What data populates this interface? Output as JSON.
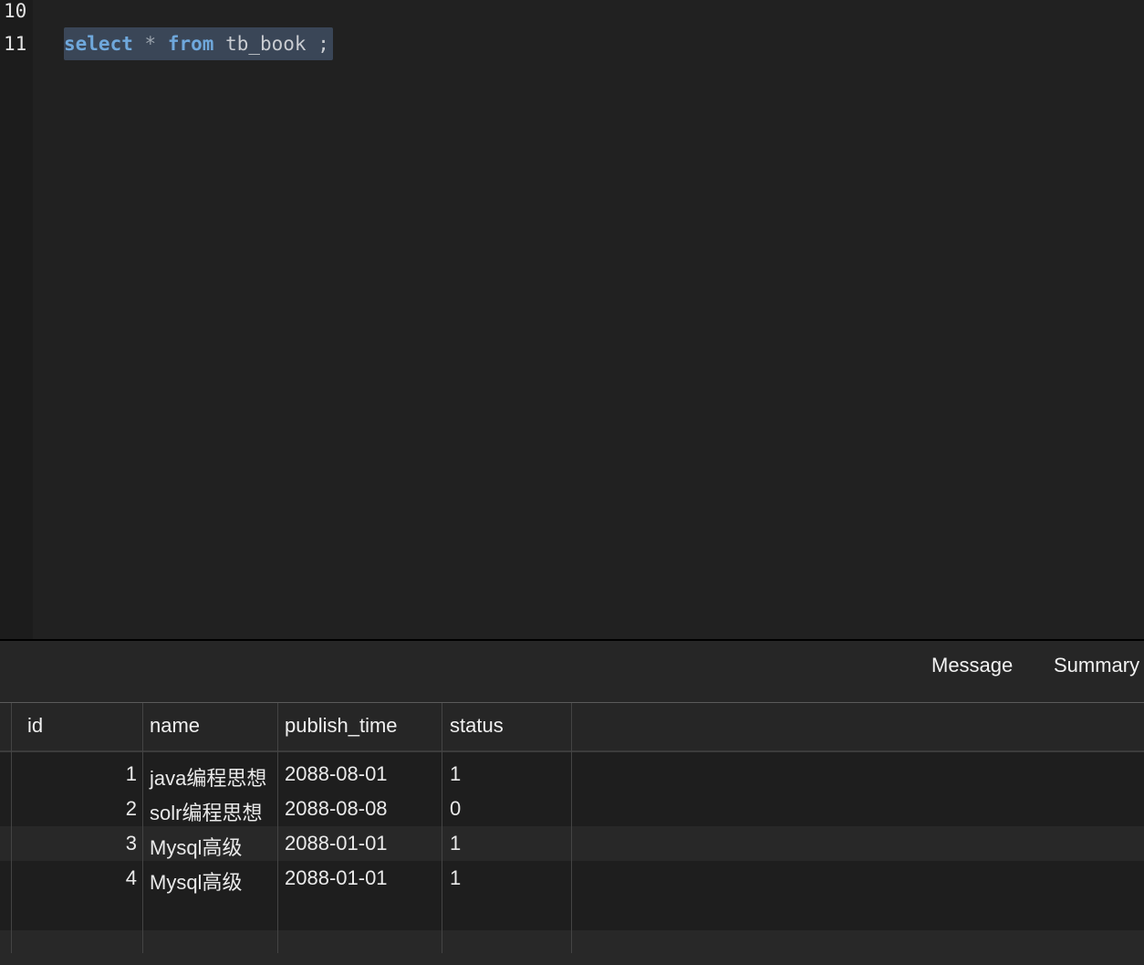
{
  "editor": {
    "line_numbers": [
      "10",
      "11"
    ],
    "query": {
      "kw_select": "select",
      "star": "*",
      "kw_from": "from",
      "table": "tb_book",
      "semicolon": ";"
    }
  },
  "results": {
    "tabs": [
      "Message",
      "Summary"
    ],
    "columns": [
      "id",
      "name",
      "publish_time",
      "status"
    ],
    "rows": [
      {
        "id": "1",
        "name": "java编程思想",
        "publish_time": "2088-08-01",
        "status": "1"
      },
      {
        "id": "2",
        "name": "solr编程思想",
        "publish_time": "2088-08-08",
        "status": "0"
      },
      {
        "id": "3",
        "name": "Mysql高级",
        "publish_time": "2088-01-01",
        "status": "1"
      },
      {
        "id": "4",
        "name": "Mysql高级",
        "publish_time": "2088-01-01",
        "status": "1"
      }
    ]
  }
}
